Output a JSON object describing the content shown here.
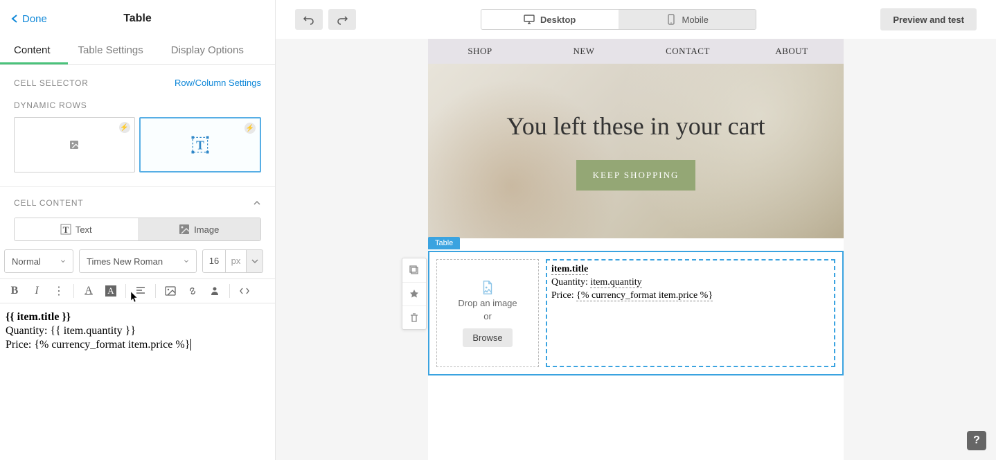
{
  "sidebar": {
    "back_label": "Done",
    "title": "Table",
    "tabs": {
      "content": "Content",
      "settings": "Table Settings",
      "display": "Display Options"
    },
    "cell_selector": "CELL SELECTOR",
    "row_col_link": "Row/Column Settings",
    "dynamic_rows": "DYNAMIC ROWS",
    "cell_content": "CELL CONTENT",
    "toggle": {
      "text": "Text",
      "image": "Image"
    },
    "style_select": "Normal",
    "font_select": "Times New Roman",
    "font_size": "16",
    "font_unit": "px"
  },
  "editor": {
    "line1": "{{ item.title }}",
    "line2": "Quantity: {{ item.quantity }}",
    "line3": "Price: {% currency_format item.price %}"
  },
  "header": {
    "desktop": "Desktop",
    "mobile": "Mobile",
    "preview": "Preview and test"
  },
  "email": {
    "nav": [
      "SHOP",
      "NEW",
      "CONTACT",
      "ABOUT"
    ],
    "hero_title": "You left these in your cart",
    "hero_btn": "KEEP SHOPPING",
    "table_label": "Table",
    "imgcell": {
      "drop": "Drop an image",
      "or": "or",
      "browse": "Browse"
    },
    "textcell": {
      "title": "item.title",
      "qty_label": "Quantity: ",
      "qty_val": "item.quantity",
      "price_label": "Price: ",
      "price_val": "{% currency_format item.price %}"
    }
  }
}
